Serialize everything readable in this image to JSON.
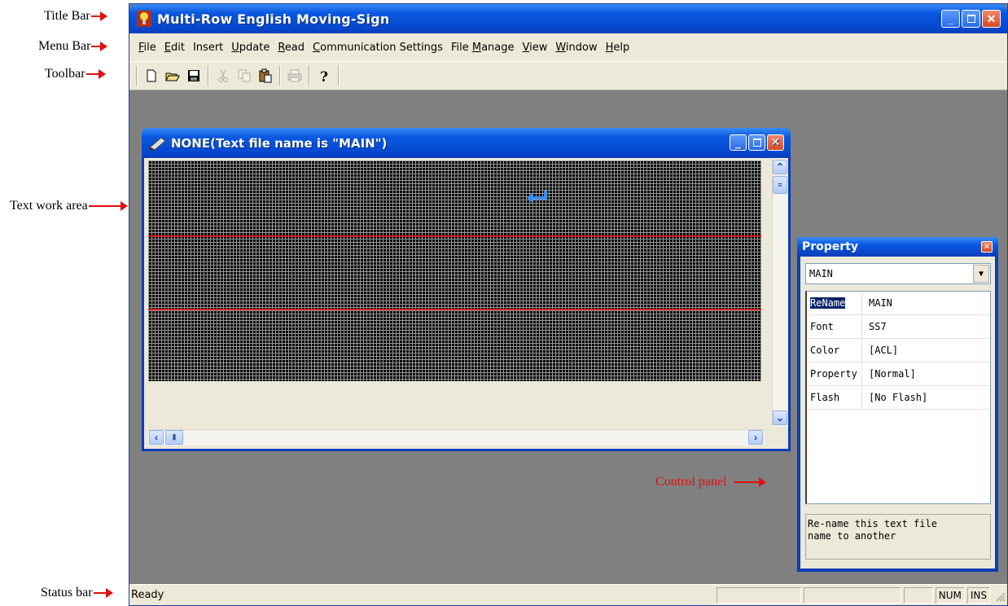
{
  "annotations": {
    "title_bar": "Title Bar",
    "menu_bar": "Menu Bar",
    "toolbar": "Toolbar",
    "text_work_area": "Text work area",
    "status_bar": "Status bar",
    "control_panel": "Control panel"
  },
  "window": {
    "title": "Multi-Row English Moving-Sign"
  },
  "menu": {
    "items": [
      {
        "accel": "F",
        "rest": "ile"
      },
      {
        "accel": "E",
        "rest": "dit"
      },
      {
        "accel": "",
        "rest": "Insert"
      },
      {
        "accel": "U",
        "rest": "pdate"
      },
      {
        "accel": "R",
        "rest": "ead"
      },
      {
        "accel": "C",
        "rest": "ommunication Settings"
      },
      {
        "pre": "File ",
        "accel": "M",
        "rest": "anage"
      },
      {
        "accel": "V",
        "rest": "iew"
      },
      {
        "accel": "W",
        "rest": "indow"
      },
      {
        "accel": "H",
        "rest": "elp"
      }
    ]
  },
  "child_window": {
    "title": "NONE(Text file name is \"MAIN\")"
  },
  "property_panel": {
    "title": "Property",
    "selected_file": "MAIN",
    "rows": [
      {
        "key": "ReName",
        "value": "MAIN"
      },
      {
        "key": "Font",
        "value": "SS7"
      },
      {
        "key": "Color",
        "value": "[ACL]"
      },
      {
        "key": "Property",
        "value": "[Normal]"
      },
      {
        "key": "Flash",
        "value": "[No Flash]"
      }
    ],
    "description_line1": "Re-name this text file",
    "description_line2": "name to another"
  },
  "status_bar": {
    "text": "Ready",
    "num": "NUM",
    "ins": "INS"
  },
  "colors": {
    "title_blue": "#0a58e0",
    "annotation_red": "#e01010",
    "workspace_gray": "#808080"
  }
}
